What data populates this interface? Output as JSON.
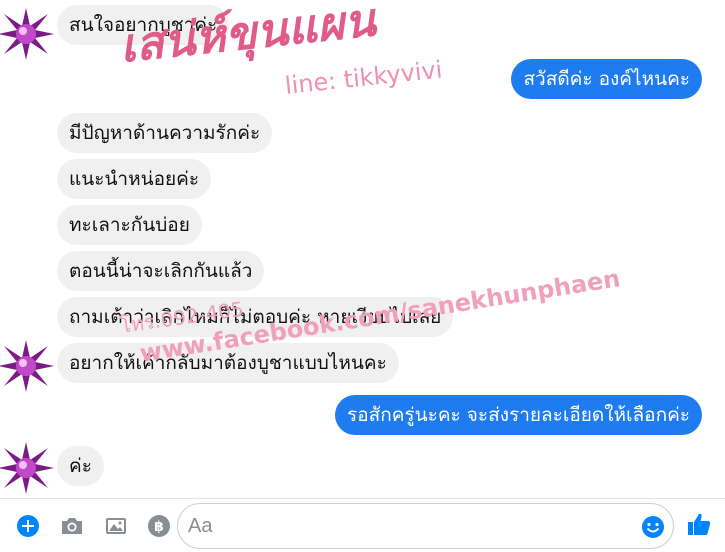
{
  "messages": [
    {
      "side": "in",
      "text": "สนใจอยากบูชาค่ะ"
    },
    {
      "side": "out",
      "text": "สวัสดีค่ะ  องค์ไหนคะ"
    },
    {
      "side": "in",
      "text": "มีปัญหาด้านความรักค่ะ"
    },
    {
      "side": "in",
      "text": "แนะนำหน่อยค่ะ"
    },
    {
      "side": "in",
      "text": "ทะเลาะกันบ่อย"
    },
    {
      "side": "in",
      "text": "ตอนนี้น่าจะเลิกกันแล้ว"
    },
    {
      "side": "in",
      "text": "ถามเต้าว่าเลิกไหมก็ไม่ตอบค่ะ หายเงียบไปเลย"
    },
    {
      "side": "in",
      "text": "อยากให้เค้ากลับมาต้องบูชาแบบไหนคะ"
    },
    {
      "side": "out",
      "text": "รอสักครู่นะคะ  จะส่งรายละเอียดให้เลือกค่ะ"
    },
    {
      "side": "in",
      "text": "ค่ะ"
    }
  ],
  "watermark": {
    "brand": "เสน่ห์ขุนแผน",
    "line_id": "line: tikkyvivi",
    "phone": "โทร.092-405",
    "url": "www.facebook.com/sanekhunphaen"
  },
  "composer": {
    "placeholder": "Aa",
    "value": "",
    "icons": [
      "add-icon",
      "camera-icon",
      "image-icon",
      "baht-payment-icon",
      "emoji-icon",
      "like-thumb-icon"
    ]
  },
  "colors": {
    "outgoing_bubble": "#1e7cf0",
    "incoming_bubble": "#f1f0f0",
    "accent": "#0084ff",
    "avatar": "#8a1a8a"
  }
}
